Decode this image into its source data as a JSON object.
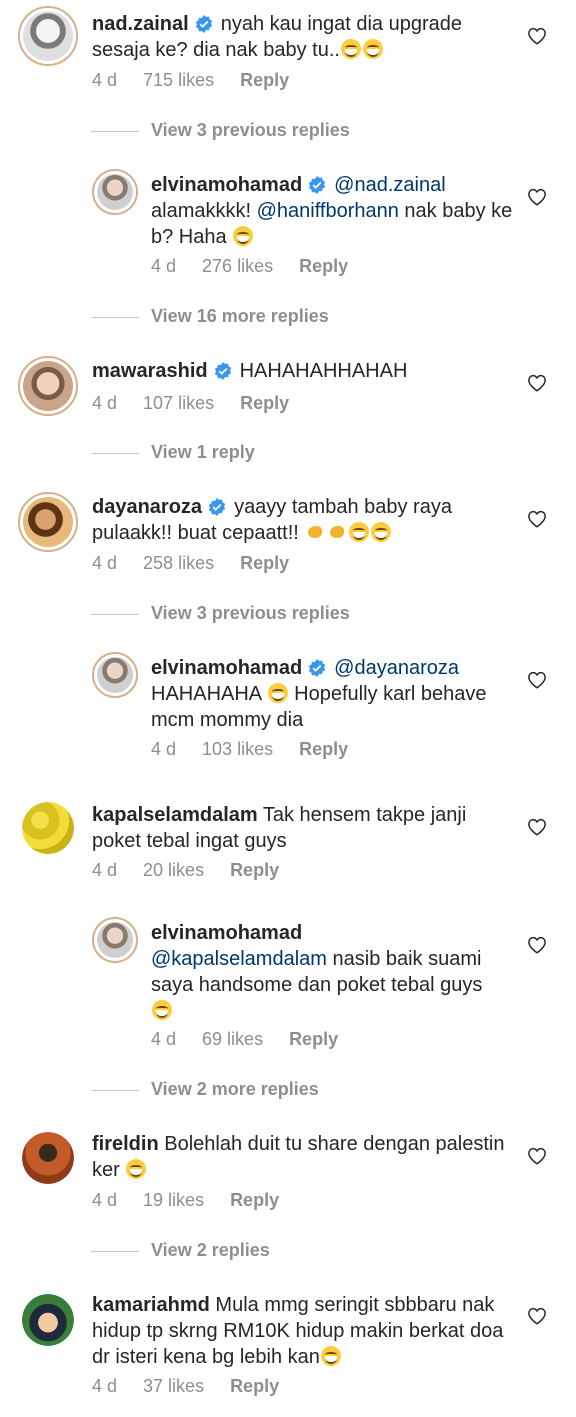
{
  "colors": {
    "text": "#262626",
    "muted": "#8e8e8e",
    "mention": "#00376b",
    "verified": "#3897f0",
    "divider": "#c7c7c7"
  },
  "comments": [
    {
      "username": "nad.zainal",
      "verified": true,
      "text": "nyah kau ingat dia upgrade sesaja ke? dia nak baby tu..",
      "emoji": "😆😆",
      "age": "4 d",
      "likes": "715 likes",
      "reply": "Reply"
    },
    {
      "username": "elvinamohamad",
      "verified": true,
      "mention": "@nad.zainal",
      "text_parts": [
        "alamakkkk! ",
        "@haniffborhann",
        " nak baby ke b? Haha "
      ],
      "emoji": "😆",
      "age": "4 d",
      "likes": "276 likes",
      "reply": "Reply"
    },
    {
      "username": "mawarashid",
      "verified": true,
      "text": "HAHAHAHHAHAH",
      "age": "4 d",
      "likes": "107 likes",
      "reply": "Reply"
    },
    {
      "username": "dayanaroza",
      "verified": true,
      "text": "yaayy tambah baby raya pulaakk!! buat cepaatt!!",
      "emoji": "💪💪😆😆",
      "age": "4 d",
      "likes": "258 likes",
      "reply": "Reply"
    },
    {
      "username": "elvinamohamad",
      "verified": true,
      "mention": "@dayanaroza",
      "text_parts": [
        "HAHAHAHA ",
        "Hopefully karl behave mcm mommy dia"
      ],
      "emoji": "😆",
      "age": "4 d",
      "likes": "103 likes",
      "reply": "Reply"
    },
    {
      "username": "kapalselamdalam",
      "verified": false,
      "text": "Tak hensem takpe janji poket tebal ingat guys",
      "age": "4 d",
      "likes": "20 likes",
      "reply": "Reply"
    },
    {
      "username": "elvinamohamad",
      "verified": false,
      "mention": "@kapalselamdalam",
      "text": "nasib baik suami saya handsome dan poket tebal guys",
      "emoji": "😆",
      "age": "4 d",
      "likes": "69 likes",
      "reply": "Reply"
    },
    {
      "username": "fireldin",
      "verified": false,
      "text": "Bolehlah duit tu share dengan palestin ker",
      "emoji": "😅",
      "age": "4 d",
      "likes": "19 likes",
      "reply": "Reply"
    },
    {
      "username": "kamariahmd",
      "verified": false,
      "text": "Mula mmg seringit sbbbaru nak hidup tp skrng RM10K hidup makin berkat doa dr isteri kena bg lebih kan",
      "emoji": "😆",
      "age": "4 d",
      "likes": "37 likes",
      "reply": "Reply"
    }
  ],
  "view_links": [
    "View 3 previous replies",
    "View 16 more replies",
    "View 1 reply",
    "View 3 previous replies",
    "View 2 more replies",
    "View 2 replies"
  ],
  "icons": {
    "heart": "heart-outline-icon",
    "verified": "verified-badge-icon",
    "avatar": "avatar-icon"
  }
}
